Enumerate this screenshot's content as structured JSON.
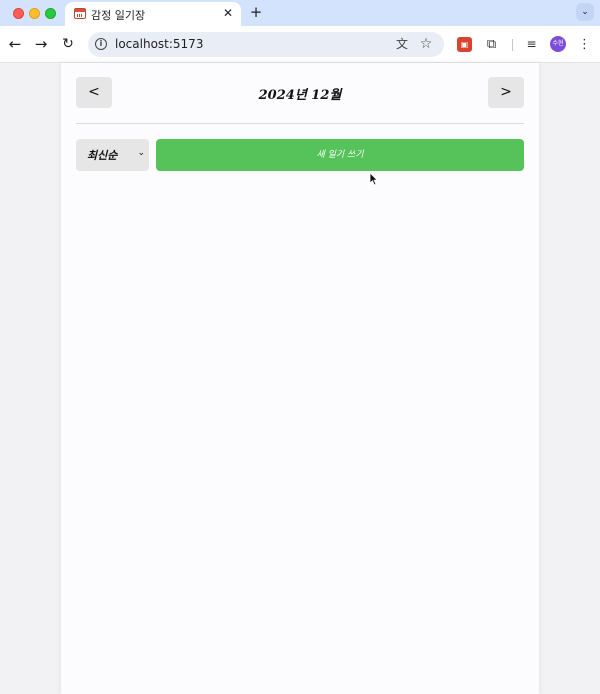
{
  "browser": {
    "tab_title": "감정 일기장",
    "tab_close": "✕",
    "new_tab": "+",
    "tab_search": "⌄",
    "url": "localhost:5173",
    "back": "←",
    "forward": "→",
    "reload": "↻",
    "site_info": "i",
    "translate_icon": "文",
    "star_icon": "☆",
    "ext_icon": "▣",
    "puzzle_icon": "⧉",
    "media_icon": "≡",
    "avatar_text": "수현",
    "menu_icon": "⋮"
  },
  "header": {
    "prev_label": "<",
    "title": "2024년 12월",
    "next_label": ">"
  },
  "controls": {
    "sort_selected": "최신순",
    "sort_arrow": "⌄",
    "new_button_label": "새 일기 쓰기"
  },
  "colors": {
    "accent_green": "#56c25a",
    "button_gray": "#e6e6e6",
    "tab_bar": "#d3e3fd"
  }
}
